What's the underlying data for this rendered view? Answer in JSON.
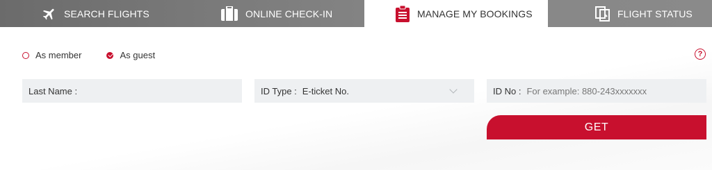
{
  "tabs": [
    {
      "label": "SEARCH FLIGHTS",
      "icon": "airplane-icon"
    },
    {
      "label": "ONLINE CHECK-IN",
      "icon": "luggage-icon"
    },
    {
      "label": "MANAGE MY BOOKINGS",
      "icon": "clipboard-icon",
      "active": true
    },
    {
      "label": "FLIGHT STATUS",
      "icon": "document-copy-icon"
    }
  ],
  "login_mode": {
    "options": [
      {
        "label": "As member",
        "selected": false
      },
      {
        "label": "As guest",
        "selected": true
      }
    ]
  },
  "help": {
    "icon": "help-icon",
    "glyph": "?"
  },
  "form": {
    "last_name_label": "Last Name :",
    "id_type_label": "ID Type :",
    "id_type_value": "E-ticket No.",
    "id_no_label": "ID No :",
    "id_no_placeholder": "For example: 880-243xxxxxxx",
    "submit_label": "GET"
  },
  "colors": {
    "accent": "#c8102e",
    "tabbar": "#7a7a7a",
    "field_bg": "#eef0f2"
  }
}
